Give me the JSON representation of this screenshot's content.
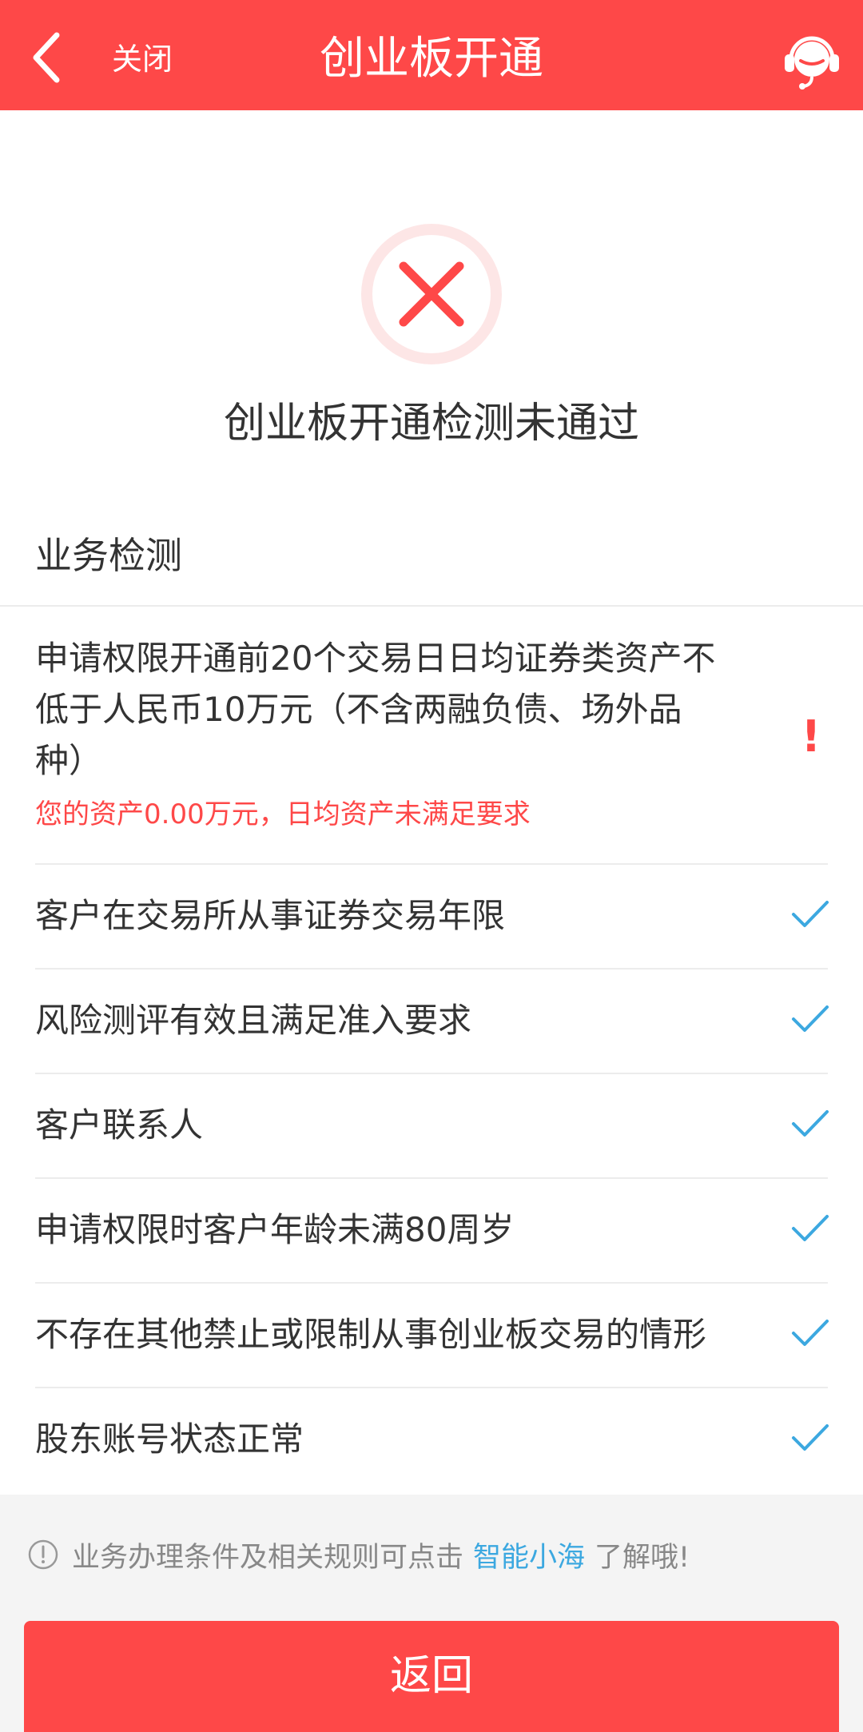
{
  "header": {
    "close_label": "关闭",
    "title": "创业板开通"
  },
  "result": {
    "title": "创业板开通检测未通过",
    "status": "failed"
  },
  "section": {
    "title": "业务检测"
  },
  "failed_item": {
    "text": "申请权限开通前20个交易日日均证券类资产不低于人民币10万元（不含两融负债、场外品种）",
    "note": "您的资产0.00万元，日均资产未满足要求",
    "status_icon": "exclamation-icon"
  },
  "checks": [
    {
      "label": "客户在交易所从事证券交易年限",
      "status": "passed"
    },
    {
      "label": "风险测评有效且满足准入要求",
      "status": "passed"
    },
    {
      "label": "客户联系人",
      "status": "passed"
    },
    {
      "label": "申请权限时客户年龄未满80周岁",
      "status": "passed"
    },
    {
      "label": "不存在其他禁止或限制从事创业板交易的情形",
      "status": "passed"
    },
    {
      "label": "股东账号状态正常",
      "status": "passed"
    }
  ],
  "tip": {
    "prefix": "业务办理条件及相关规则可点击",
    "link": "智能小海",
    "suffix": "了解哦!"
  },
  "footer": {
    "return_label": "返回"
  },
  "colors": {
    "brand_red": "#fe4848",
    "check_blue": "#3ca8e0",
    "text_dark": "#333333",
    "text_gray": "#888888"
  }
}
